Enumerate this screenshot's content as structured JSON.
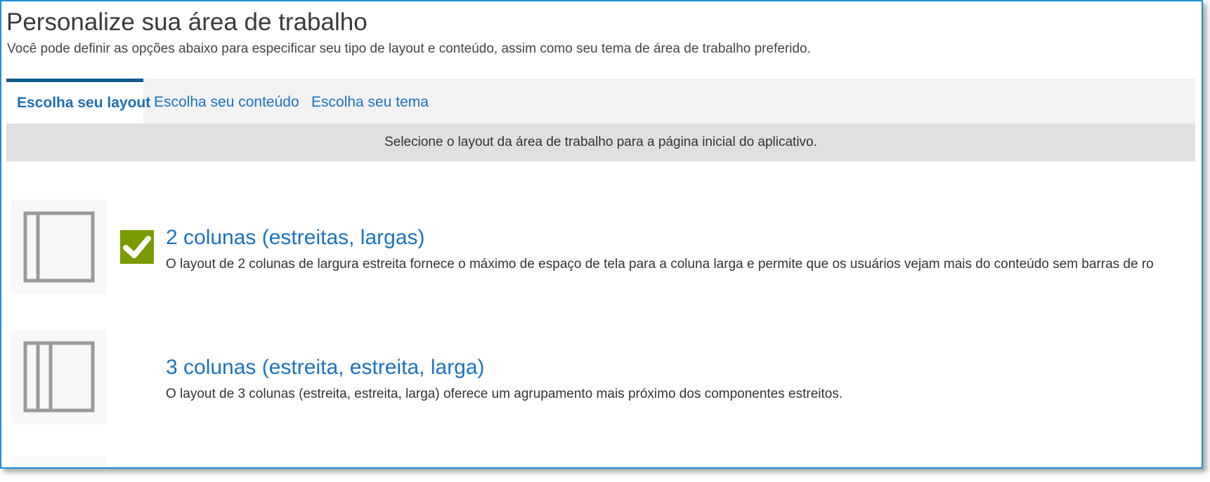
{
  "header": {
    "title": "Personalize sua área de trabalho",
    "subtitle": "Você pode definir as opções abaixo para especificar seu tipo de layout e conteúdo, assim como seu tema de área de trabalho preferido."
  },
  "tabs": [
    {
      "label": "Escolha seu layout",
      "active": true
    },
    {
      "label": "Escolha seu conteúdo",
      "active": false
    },
    {
      "label": "Escolha seu tema",
      "active": false
    }
  ],
  "instruction": "Selecione o layout da área de trabalho para a página inicial do aplicativo.",
  "layouts": [
    {
      "title": "2 colunas (estreitas, largas)",
      "description": "O layout de 2 colunas de largura estreita fornece o máximo de espaço de tela para a coluna larga e permite que os usuários vejam mais do conteúdo sem barras de ro",
      "selected": true,
      "icon": "two-column-layout-icon"
    },
    {
      "title": "3 colunas (estreita, estreita, larga)",
      "description": "O layout de 3 colunas (estreita, estreita, larga) oferece um agrupamento mais próximo dos componentes estreitos.",
      "selected": false,
      "icon": "three-column-layout-icon"
    }
  ],
  "colors": {
    "frame_border": "#1a8fd6",
    "link_blue": "#1a73c0",
    "active_tab_border": "#0e5a8e",
    "checkmark_green": "#7a9a01",
    "thumbnail_gray": "#9a9a9a"
  }
}
